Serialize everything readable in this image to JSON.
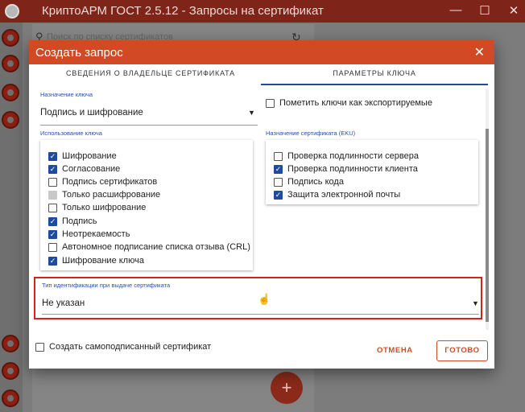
{
  "app": {
    "title": "КриптоАРМ ГОСТ 2.5.12 - Запросы на сертификат",
    "minimize": "—",
    "maximize": "☐",
    "close": "✕",
    "search_placeholder": "Поиск по списку сертификатов",
    "add_button": "+"
  },
  "dialog": {
    "title": "Создать запрос",
    "close": "✕",
    "tabs": [
      {
        "label": "СВЕДЕНИЯ О ВЛАДЕЛЬЦЕ СЕРТИФИКАТА",
        "active": false
      },
      {
        "label": "ПАРАМЕТРЫ КЛЮЧА",
        "active": true
      }
    ],
    "key_purpose": {
      "label": "Назначение ключа",
      "value": "Подпись и шифрование"
    },
    "exportable": {
      "label": "Пометить ключи как экспортируемые",
      "checked": false
    },
    "key_usage": {
      "label": "Использование ключа",
      "items": [
        {
          "label": "Шифрование",
          "state": "on"
        },
        {
          "label": "Согласование",
          "state": "on"
        },
        {
          "label": "Подпись сертификатов",
          "state": "off"
        },
        {
          "label": "Только расшифрование",
          "state": "disabled"
        },
        {
          "label": "Только шифрование",
          "state": "off"
        },
        {
          "label": "Подпись",
          "state": "on"
        },
        {
          "label": "Неотрекаемость",
          "state": "on"
        },
        {
          "label": "Автономное подписание списка отзыва (CRL)",
          "state": "off"
        },
        {
          "label": "Шифрование ключа",
          "state": "on"
        }
      ]
    },
    "eku": {
      "label": "Назначение сертификата (EKU)",
      "items": [
        {
          "label": "Проверка подлинности сервера",
          "state": "off"
        },
        {
          "label": "Проверка подлинности клиента",
          "state": "on"
        },
        {
          "label": "Подпись кода",
          "state": "off"
        },
        {
          "label": "Защита электронной почты",
          "state": "on"
        }
      ]
    },
    "id_type": {
      "label": "Тип идентификации при выдаче сертификата",
      "value": "Не указан"
    },
    "self_signed": {
      "label": "Создать самоподписанный сертификат",
      "checked": false
    },
    "cancel_label": "ОТМЕНА",
    "ok_label": "ГОТОВО",
    "accent_color": "#d24a25",
    "checkbox_color": "#1f4aa0",
    "highlight_color": "#d42020"
  }
}
